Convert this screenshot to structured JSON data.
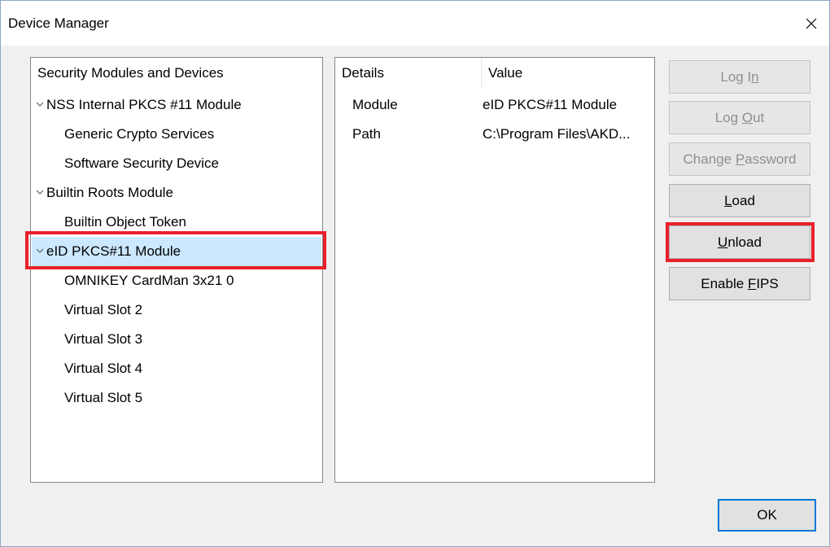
{
  "window": {
    "title": "Device Manager"
  },
  "tree": {
    "header": "Security Modules and Devices",
    "rows": [
      {
        "label": "NSS Internal PKCS #11 Module",
        "expanded": true
      },
      {
        "label": "Generic Crypto Services"
      },
      {
        "label": "Software Security Device"
      },
      {
        "label": "Builtin Roots Module",
        "expanded": true
      },
      {
        "label": "Builtin Object Token"
      },
      {
        "label": "eID PKCS#11 Module",
        "expanded": true,
        "selected": true
      },
      {
        "label": "OMNIKEY CardMan 3x21 0"
      },
      {
        "label": "Virtual Slot 2"
      },
      {
        "label": "Virtual Slot 3"
      },
      {
        "label": "Virtual Slot 4"
      },
      {
        "label": "Virtual Slot 5"
      }
    ]
  },
  "details": {
    "columns": [
      "Details",
      "Value"
    ],
    "rows": [
      {
        "key": "Module",
        "value": "eID PKCS#11 Module"
      },
      {
        "key": "Path",
        "value": "C:\\Program Files\\AKD..."
      }
    ]
  },
  "buttons": {
    "login": {
      "pre": "Log I",
      "mn": "n",
      "post": "",
      "enabled": false
    },
    "logout": {
      "pre": "Log ",
      "mn": "O",
      "post": "ut",
      "enabled": false
    },
    "change_password": {
      "pre": "Change ",
      "mn": "P",
      "post": "assword",
      "enabled": false
    },
    "load": {
      "pre": "",
      "mn": "L",
      "post": "oad",
      "enabled": true
    },
    "unload": {
      "pre": "",
      "mn": "U",
      "post": "nload",
      "enabled": true
    },
    "enable_fips": {
      "pre": "Enable ",
      "mn": "F",
      "post": "IPS",
      "enabled": true
    },
    "ok": "OK"
  },
  "colors": {
    "selection": "#cce8ff",
    "highlight": "#e8202a",
    "focus_border": "#0078d7"
  },
  "icons": {
    "close": "close-icon",
    "expand": "chevron-down-icon"
  }
}
